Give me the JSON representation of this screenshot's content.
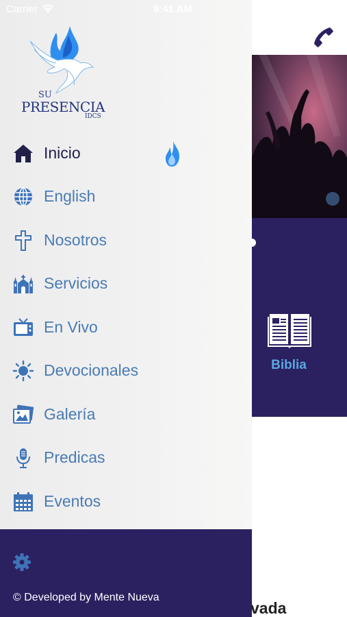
{
  "status_bar": {
    "carrier": "Carrier",
    "time": "9:41 AM"
  },
  "logo": {
    "line1": "SU",
    "line2": "PRESENCIA",
    "line3": "IDCS"
  },
  "menu": {
    "items": [
      {
        "label": "Inicio",
        "icon": "home-icon"
      },
      {
        "label": "English",
        "icon": "globe-icon"
      },
      {
        "label": "Nosotros",
        "icon": "cross-icon"
      },
      {
        "label": "Servicios",
        "icon": "church-icon"
      },
      {
        "label": "En Vivo",
        "icon": "tv-icon"
      },
      {
        "label": "Devocionales",
        "icon": "sun-icon"
      },
      {
        "label": "Galería",
        "icon": "gallery-icon"
      },
      {
        "label": "Predicas",
        "icon": "microphone-icon"
      },
      {
        "label": "Eventos",
        "icon": "calendar-icon"
      }
    ],
    "active_index": 0
  },
  "footer": {
    "credit": "© Developed by Mente Nueva"
  },
  "background_app": {
    "tile_label": "Biblia",
    "below_text": "vada"
  },
  "colors": {
    "accent_dark": "#2b2060",
    "menu_text": "#4a7bb4",
    "active_text": "#20204a",
    "tile_label": "#5aa7e0",
    "flame": "#2f8ff0"
  }
}
